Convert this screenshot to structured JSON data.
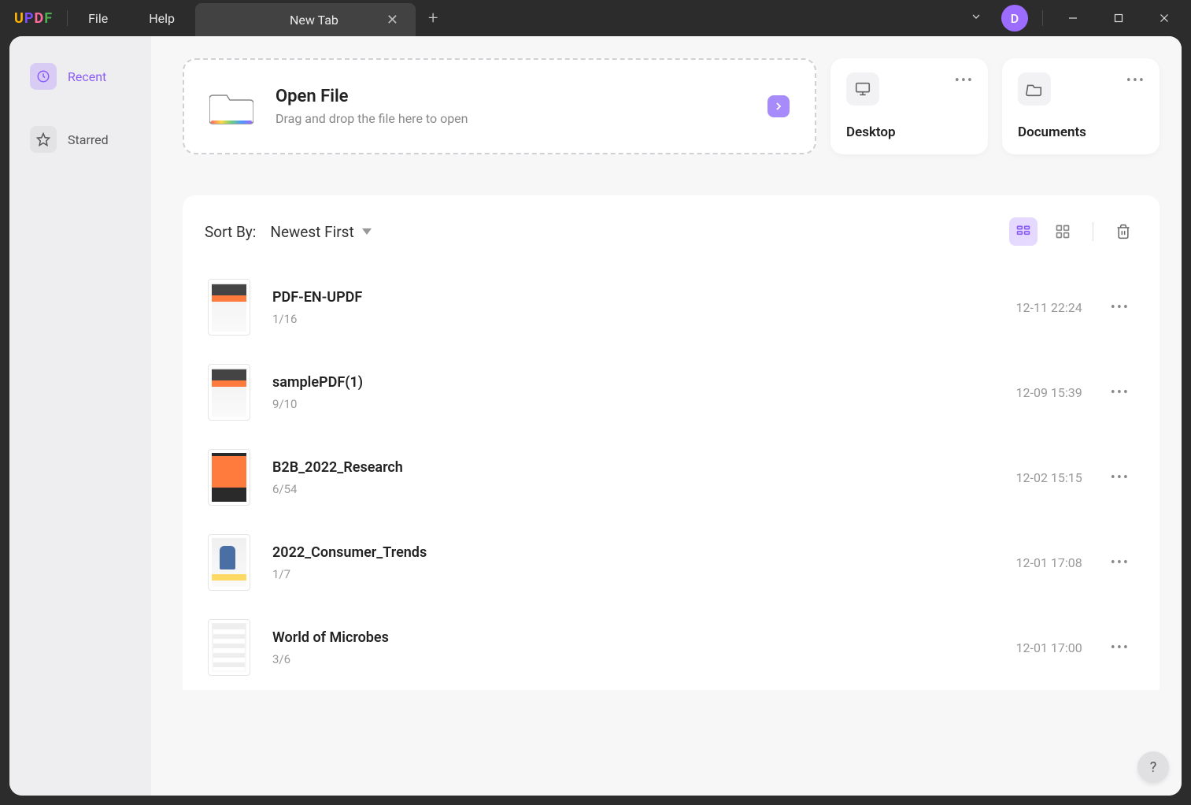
{
  "app": {
    "logo": "UPDF"
  },
  "menu": [
    "File",
    "Help"
  ],
  "tab": {
    "title": "New Tab"
  },
  "avatar": "D",
  "sidebar": {
    "items": [
      {
        "label": "Recent",
        "active": true
      },
      {
        "label": "Starred",
        "active": false
      }
    ]
  },
  "open": {
    "title": "Open File",
    "subtitle": "Drag and drop the file here to open"
  },
  "locations": [
    {
      "label": "Desktop",
      "icon": "desktop"
    },
    {
      "label": "Documents",
      "icon": "folder"
    }
  ],
  "sort": {
    "label": "Sort By:",
    "value": "Newest First"
  },
  "files": [
    {
      "name": "PDF-EN-UPDF",
      "pages": "1/16",
      "date": "12-11 22:24",
      "thumbStyle": "doc1"
    },
    {
      "name": "samplePDF(1)",
      "pages": "9/10",
      "date": "12-09 15:39",
      "thumbStyle": "doc1"
    },
    {
      "name": "B2B_2022_Research",
      "pages": "6/54",
      "date": "12-02 15:15",
      "thumbStyle": "dark"
    },
    {
      "name": "2022_Consumer_Trends",
      "pages": "1/7",
      "date": "12-01 17:08",
      "thumbStyle": "light"
    },
    {
      "name": "World of Microbes",
      "pages": "3/6",
      "date": "12-01 17:00",
      "thumbStyle": "table"
    }
  ],
  "help": "?"
}
